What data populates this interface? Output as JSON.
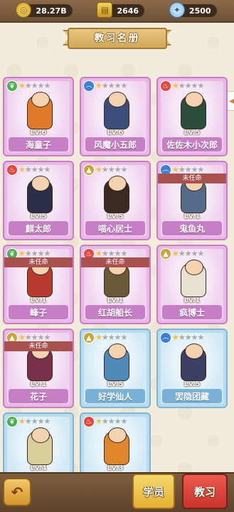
{
  "top_bar": {
    "resources": [
      {
        "name": "coin",
        "icon": "coin-icon",
        "value": "28.27B"
      },
      {
        "name": "gold",
        "icon": "gold-bar-icon",
        "value": "2646"
      },
      {
        "name": "gem",
        "icon": "gem-icon",
        "value": "2500"
      }
    ]
  },
  "header": {
    "title": "教习名册"
  },
  "cards": [
    {
      "name": "海童子",
      "level": "Lv.6",
      "element": "leaf",
      "element_color": "#4caf50",
      "stars_on": 1,
      "stars_total": 5,
      "theme": "purple",
      "unassigned": false,
      "char_color": "#e07a2a"
    },
    {
      "name": "风魔小五郎",
      "level": "Lv.6",
      "element": "wind",
      "element_color": "#3b7fd6",
      "stars_on": 1,
      "stars_total": 5,
      "theme": "purple",
      "unassigned": false,
      "char_color": "#3b4d7a"
    },
    {
      "name": "佐佐木小次郎",
      "level": "Lv.5",
      "element": "fire",
      "element_color": "#e2473d",
      "stars_on": 1,
      "stars_total": 5,
      "theme": "purple",
      "unassigned": false,
      "char_color": "#2b4d3b"
    },
    {
      "name": "麒太郎",
      "level": "Lv.5",
      "element": "fire",
      "element_color": "#e2473d",
      "stars_on": 1,
      "stars_total": 5,
      "theme": "purple",
      "unassigned": false,
      "char_color": "#2b2f4a"
    },
    {
      "name": "喵心居士",
      "level": "Lv.5",
      "element": "mountain",
      "element_color": "#c9a63a",
      "stars_on": 1,
      "stars_total": 5,
      "theme": "purple",
      "unassigned": false,
      "char_color": "#3a2a22"
    },
    {
      "name": "鬼鱼丸",
      "level": "Lv.1",
      "element": "wind",
      "element_color": "#3b7fd6",
      "stars_on": 1,
      "stars_total": 5,
      "theme": "purple",
      "unassigned": true,
      "char_color": "#556b8a"
    },
    {
      "name": "峰子",
      "level": "Lv.1",
      "element": "leaf",
      "element_color": "#4caf50",
      "stars_on": 1,
      "stars_total": 5,
      "theme": "purple",
      "unassigned": true,
      "char_color": "#b83a2e"
    },
    {
      "name": "红胡船长",
      "level": "Lv.1",
      "element": "fire",
      "element_color": "#e2473d",
      "stars_on": 1,
      "stars_total": 5,
      "theme": "purple",
      "unassigned": true,
      "char_color": "#6b5a3a"
    },
    {
      "name": "疯博士",
      "level": "Lv.1",
      "element": "mountain",
      "element_color": "#c9a63a",
      "stars_on": 1,
      "stars_total": 5,
      "theme": "purple",
      "unassigned": false,
      "char_color": "#e8e0d0"
    },
    {
      "name": "花子",
      "level": "Lv.1",
      "element": "mountain",
      "element_color": "#c9a63a",
      "stars_on": 1,
      "stars_total": 5,
      "theme": "purple",
      "unassigned": true,
      "char_color": "#7a2f4a"
    },
    {
      "name": "好学仙人",
      "level": "Lv.5",
      "element": "mountain",
      "element_color": "#c9a63a",
      "stars_on": 1,
      "stars_total": 5,
      "theme": "blue",
      "unassigned": false,
      "char_color": "#4e8ab8"
    },
    {
      "name": "罢隐团藏",
      "level": "Lv.5",
      "element": "wind",
      "element_color": "#3b7fd6",
      "stars_on": 1,
      "stars_total": 5,
      "theme": "blue",
      "unassigned": false,
      "char_color": "#3b3f66"
    },
    {
      "name": "",
      "level": "Lv.4",
      "element": "leaf",
      "element_color": "#4caf50",
      "stars_on": 1,
      "stars_total": 5,
      "theme": "blue",
      "unassigned": false,
      "char_color": "#d9cf9a"
    },
    {
      "name": "",
      "level": "Lv.3",
      "element": "fire",
      "element_color": "#e2473d",
      "stars_on": 1,
      "stars_total": 5,
      "theme": "blue",
      "unassigned": false,
      "char_color": "#e0862a"
    }
  ],
  "unassigned_label": "未任命",
  "bottom_bar": {
    "back_icon": "back-arrow-icon",
    "students_label": "学员",
    "teach_label": "教习"
  }
}
